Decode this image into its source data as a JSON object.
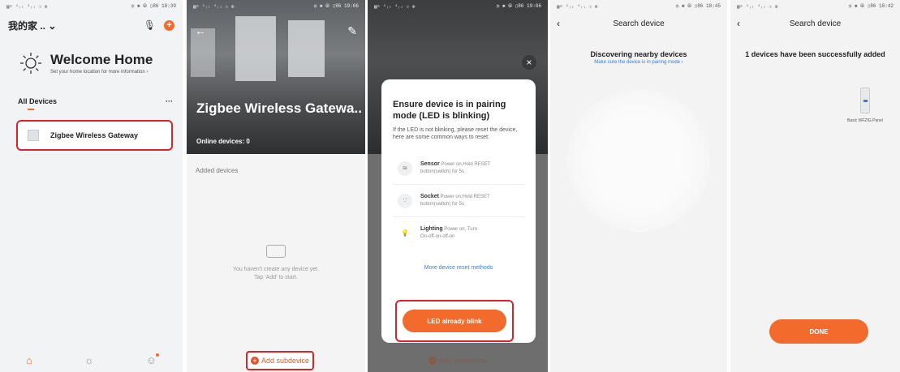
{
  "panel1": {
    "status_left": "▥ᵃ ⁴ᵢₗ ⁴ᵢₗ ☉ ⊕",
    "status_right": "◎ ✱ ⦾ ▯86 18:39",
    "home_title": "我的家 .. ⌄",
    "welcome_title": "Welcome Home",
    "welcome_sub": "Set your home location for more information ›",
    "all_devices": "All Devices",
    "more": "···",
    "device_name": "Zigbee Wireless Gateway",
    "tabs": {
      "home": "⌂",
      "scene": "☼",
      "me": "☺"
    }
  },
  "panel2": {
    "status_left": "▥ᵃ ⁴ᵢₗ ⁴ᵢₗ ☉ ⊕",
    "status_right": "◎ ✱ ⦾ ▯86 19:06",
    "title": "Zigbee Wireless Gatewa..",
    "online": "Online devices: 0",
    "added_devices": "Added devices",
    "empty_line1": "You haven't create any device yet.",
    "empty_line2": "Tap 'Add' to start.",
    "add_subdevice": "Add subdevice"
  },
  "panel3": {
    "status_left": "▥ᵃ ⁴ᵢₗ ⁴ᵢₗ ☉ ⊕",
    "status_right": "◎ ✱ ⦾ ▯86 19:06",
    "close": "×",
    "modal_title": "Ensure device is in pairing mode (LED is blinking)",
    "modal_desc": "If the LED is not blinking, please reset the device, here are some common ways to reset:",
    "methods": [
      {
        "name": "Sensor",
        "text1": "Power on,Hold RESET",
        "text2": "button(switch) for 5s",
        "icon": "≋"
      },
      {
        "name": "Socket",
        "text1": "Power on,Hold RESET",
        "text2": "button(switch) for 5s",
        "icon": "∵"
      },
      {
        "name": "Lighting",
        "text1": "Power on, Turn",
        "text2": "On-off-on-off-on",
        "icon": "💡"
      }
    ],
    "more_methods": "More device reset methods",
    "blink_button": "LED already blink",
    "add_subdevice": "Add subdevice"
  },
  "panel4": {
    "status_left": "▥ᵃ ⁴ᵢₗ ⁴ᵢₗ ☉ ⊕",
    "status_right": "◎ ✱ ⦾ ▯86 18:45",
    "title": "Search device",
    "discovering": "Discovering nearby devices",
    "pairing_hint": "Make sure the device is in pairing mode ›"
  },
  "panel5": {
    "status_left": "▥ᵃ ⁴ᵢₗ ⁴ᵢₗ ☉ ⊕",
    "status_right": "◎ ✱ ⦾ ▯86 18:42",
    "title": "Search device",
    "added": "1 devices have been successfully added",
    "device_label": "Basic WFZIG Panel",
    "done": "DONE"
  }
}
